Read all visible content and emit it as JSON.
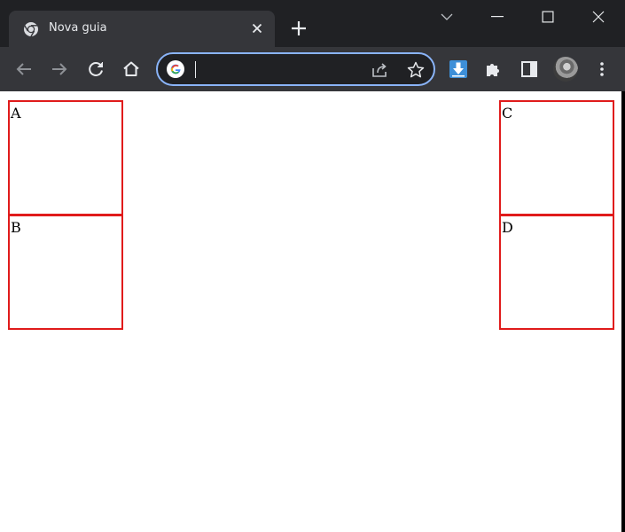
{
  "browser": {
    "tab": {
      "title": "Nova guia",
      "favicon": "chrome-icon"
    },
    "new_tab_icon": "plus-icon",
    "window_controls": [
      "tab-search-icon",
      "minimize-icon",
      "maximize-icon",
      "close-icon"
    ],
    "toolbar": {
      "nav_icons": [
        "back-icon",
        "forward-icon",
        "reload-icon",
        "home-icon"
      ],
      "omnibox": {
        "value": "",
        "icons": [
          "google-icon",
          "share-icon",
          "star-icon"
        ]
      },
      "extension_icons": [
        "download-extension-icon",
        "puzzle-icon",
        "side-panel-icon",
        "avatar",
        "menu-icon"
      ]
    }
  },
  "page": {
    "boxes": [
      {
        "label": "A"
      },
      {
        "label": "B"
      },
      {
        "label": "C"
      },
      {
        "label": "D"
      }
    ]
  },
  "colors": {
    "tabstrip_bg": "#202124",
    "toolbar_bg": "#35363a",
    "omnibox_border": "#8ab4f8",
    "box_border": "#e01b1b"
  }
}
